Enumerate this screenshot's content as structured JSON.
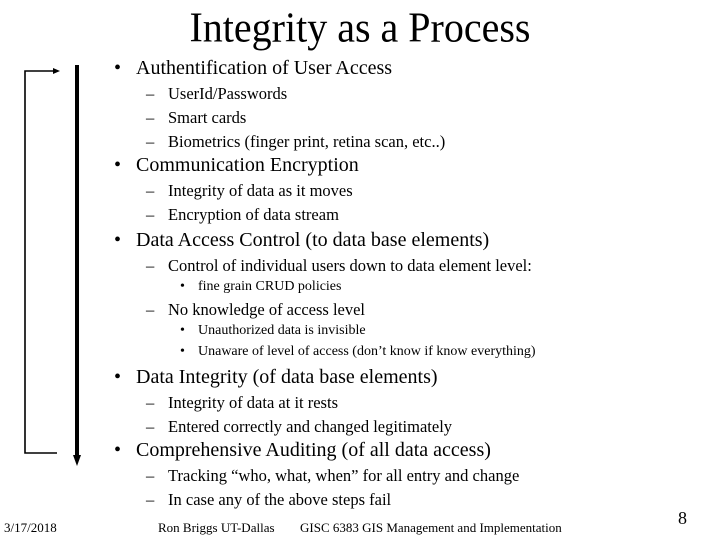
{
  "slide": {
    "title": "Integrity as a Process",
    "bullet_glyph": "•",
    "dash_glyph": "–",
    "sections": [
      {
        "heading": "Authentification of  User Access",
        "items": [
          {
            "text": "UserId/Passwords",
            "subitems": []
          },
          {
            "text": "Smart cards",
            "subitems": []
          },
          {
            "text": "Biometrics (finger print, retina scan, etc..)",
            "subitems": []
          }
        ]
      },
      {
        "heading": "Communication Encryption",
        "items": [
          {
            "text": "Integrity of data as it moves",
            "subitems": []
          },
          {
            "text": "Encryption of data stream",
            "subitems": []
          }
        ]
      },
      {
        "heading": "Data Access Control (to data base elements)",
        "items": [
          {
            "text": "Control of individual users down to data element level:",
            "subitems": [
              "fine grain CRUD policies"
            ]
          },
          {
            "text": "No knowledge of access level",
            "subitems": [
              "Unauthorized data is invisible",
              "Unaware of level of access (don’t know if know everything)"
            ]
          }
        ]
      },
      {
        "heading": "Data Integrity (of  data base elements)",
        "items": [
          {
            "text": "Integrity of data at it rests",
            "subitems": []
          },
          {
            "text": "Entered correctly and changed legitimately",
            "subitems": []
          }
        ]
      },
      {
        "heading": "Comprehensive Auditing (of all data access)",
        "items": [
          {
            "text": "Tracking “who, what, when” for all entry and change",
            "subitems": []
          },
          {
            "text": "In case any of the above steps fail",
            "subitems": []
          }
        ]
      }
    ]
  },
  "footer": {
    "date": "3/17/2018",
    "author": "Ron Briggs UT-Dallas",
    "course": "GISC 6383 GIS Management and Implementation",
    "page_number": "8"
  },
  "diagram": {
    "feedback_arrow": "loop-back-arrow",
    "process_arrow": "down-arrow"
  }
}
